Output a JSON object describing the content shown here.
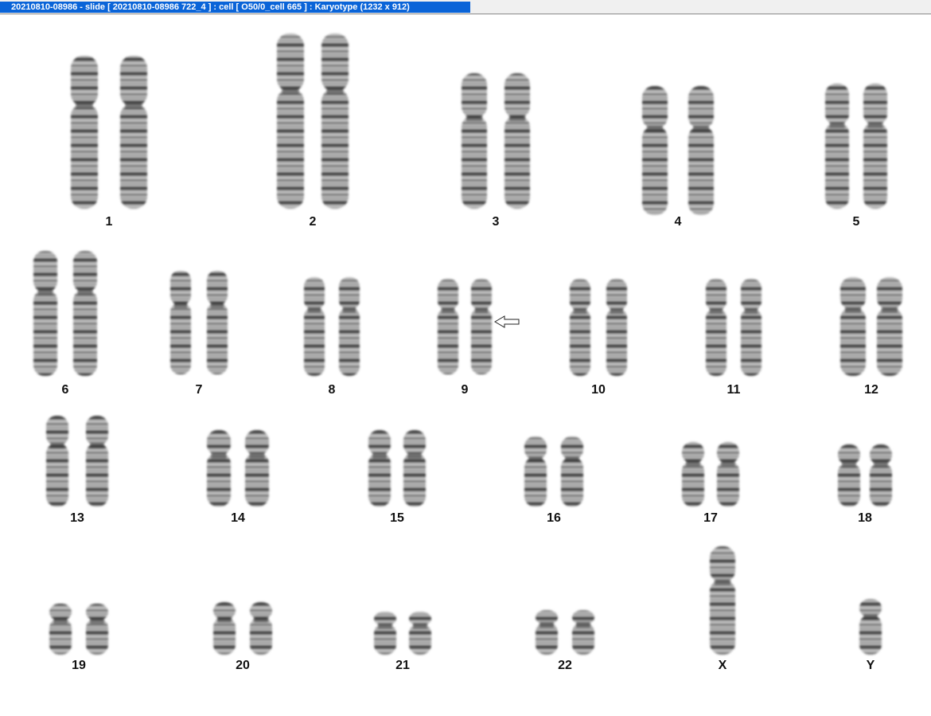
{
  "window": {
    "title": "20210810-08986 - slide [ 20210810-08986 722_4 ] : cell [ O50/0_cell 665 ] : Karyotype  (1232 x 912)"
  },
  "karyotype": {
    "chromosomes": [
      {
        "label": "1",
        "arrow": false
      },
      {
        "label": "2",
        "arrow": false
      },
      {
        "label": "3",
        "arrow": false
      },
      {
        "label": "4",
        "arrow": false
      },
      {
        "label": "5",
        "arrow": false
      },
      {
        "label": "6",
        "arrow": false
      },
      {
        "label": "7",
        "arrow": false
      },
      {
        "label": "8",
        "arrow": false
      },
      {
        "label": "9",
        "arrow": true
      },
      {
        "label": "10",
        "arrow": false
      },
      {
        "label": "11",
        "arrow": false
      },
      {
        "label": "12",
        "arrow": false
      },
      {
        "label": "13",
        "arrow": false
      },
      {
        "label": "14",
        "arrow": false
      },
      {
        "label": "15",
        "arrow": false
      },
      {
        "label": "16",
        "arrow": false
      },
      {
        "label": "17",
        "arrow": false
      },
      {
        "label": "18",
        "arrow": false
      },
      {
        "label": "19",
        "arrow": false
      },
      {
        "label": "20",
        "arrow": false
      },
      {
        "label": "21",
        "arrow": false
      },
      {
        "label": "22",
        "arrow": false
      },
      {
        "label": "X",
        "arrow": false
      },
      {
        "label": "Y",
        "arrow": false
      }
    ]
  },
  "colors": {
    "titlebar_accent": "#0a64d8",
    "chromosome_stain": "#3c3c3c"
  }
}
